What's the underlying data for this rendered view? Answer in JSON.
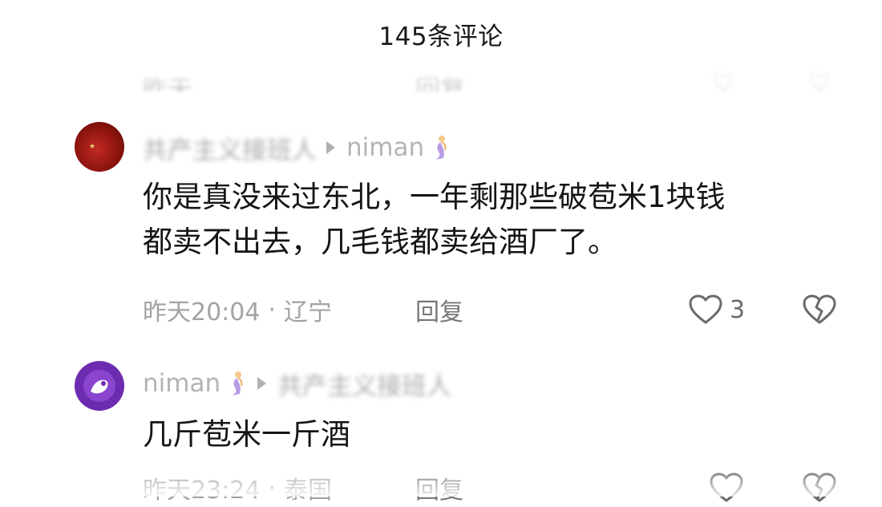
{
  "header": {
    "title": "145条评论"
  },
  "previous_row": {
    "time": "昨天",
    "location": "",
    "reply": "回复"
  },
  "comments": [
    {
      "author": "共产主义接班人",
      "reply_to": "niman",
      "text_line1": "你是真没来过东北，一年剩那些破苞米1块钱",
      "text_line2": "都卖不出去，几毛钱都卖给酒厂了。",
      "time": "昨天20:04",
      "separator": "·",
      "location": "辽宁",
      "reply_label": "回复",
      "likes": "3"
    },
    {
      "author": "niman",
      "reply_to": "共产主义接班人",
      "text_line1": "几斤苞米一斤酒",
      "time": "昨天23:24",
      "separator": "·",
      "location": "泰国",
      "reply_label": "回复",
      "likes": ""
    }
  ]
}
